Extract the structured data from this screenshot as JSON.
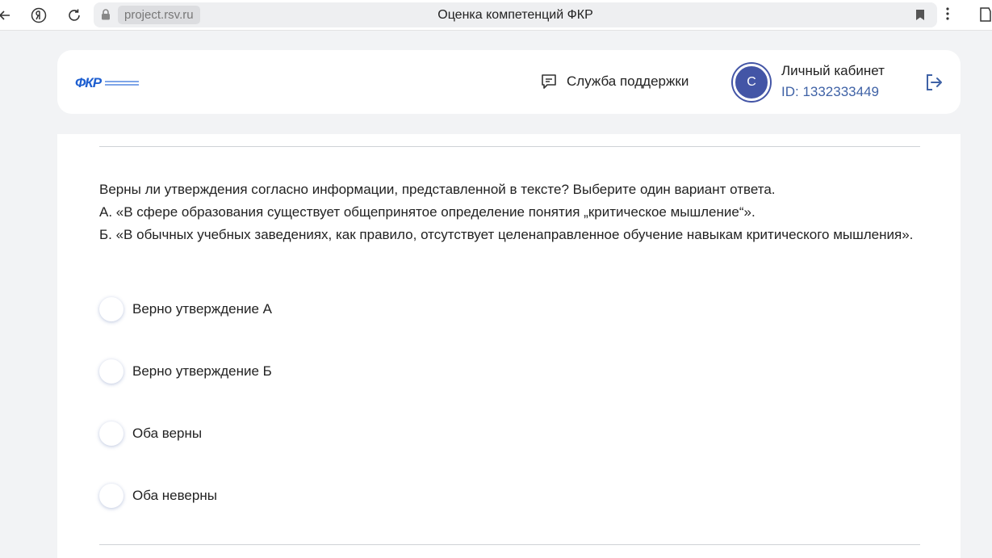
{
  "browser": {
    "url": "project.rsv.ru",
    "tab_title": "Оценка компетенций ФКР"
  },
  "header": {
    "logo_text": "ФКР",
    "support_label": "Служба поддержки",
    "avatar_letter": "С",
    "cabinet_label": "Личный кабинет",
    "user_id": "ID: 1332333449"
  },
  "question": {
    "lines": [
      "Верны ли утверждения согласно информации, представленной в тексте? Выберите один вариант ответа.",
      "А. «В сфере образования существует общепринятое определение понятия „критическое мышление“».",
      "Б. «В обычных учебных заведениях, как правило, отсутствует целенаправленное обучение навыкам критического мышления»."
    ]
  },
  "options": [
    {
      "label": "Верно утверждение А"
    },
    {
      "label": "Верно утверждение Б"
    },
    {
      "label": "Оба верны"
    },
    {
      "label": "Оба неверны"
    }
  ],
  "colors": {
    "accent": "#4355a6",
    "id_text": "#3f62a6",
    "logo": "#1e5fd0"
  }
}
